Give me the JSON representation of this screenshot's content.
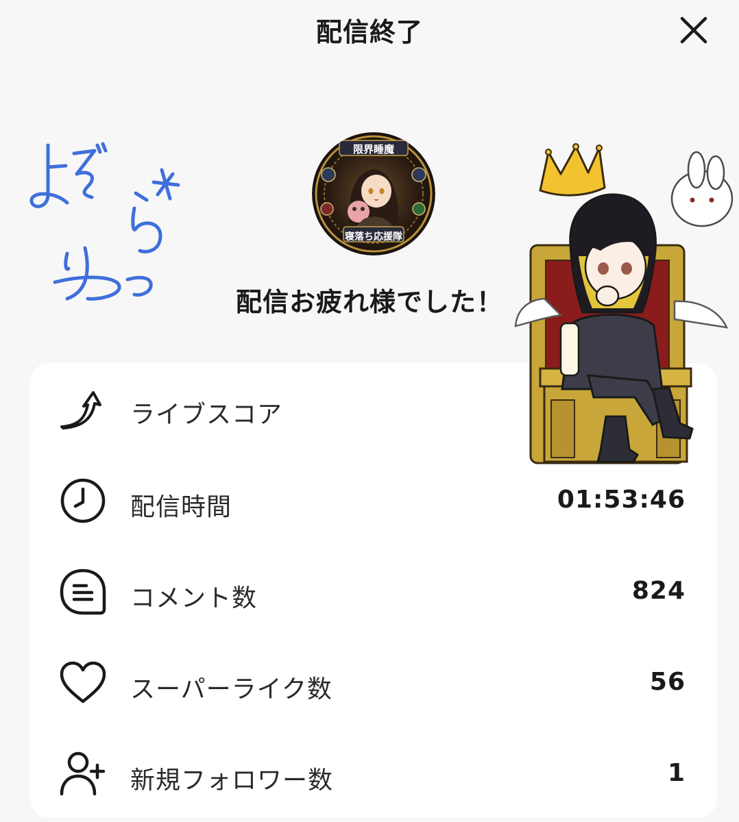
{
  "header": {
    "title": "配信終了",
    "close_icon": "close-icon"
  },
  "signature": {
    "text": "よぞらりつ",
    "color": "#3f6fdc"
  },
  "avatar": {
    "caption_top": "限界睡魔",
    "caption_bottom": "寝落ち応援隊"
  },
  "subtitle": "配信お疲れ様でした！",
  "stats": [
    {
      "icon": "trending-up-arrow-icon",
      "label": "ライブスコア",
      "value": ""
    },
    {
      "icon": "clock-icon",
      "label": "配信時間",
      "value": "01:53:46"
    },
    {
      "icon": "comment-icon",
      "label": "コメント数",
      "value": "824"
    },
    {
      "icon": "heart-icon",
      "label": "スーパーライク数",
      "value": "56"
    },
    {
      "icon": "user-plus-icon",
      "label": "新規フォロワー数",
      "value": "1"
    }
  ],
  "colors": {
    "background": "#f7f7f7",
    "card": "#ffffff",
    "text": "#1a1a1a",
    "signature_blue": "#3f6fdc",
    "crown_gold": "#f2c230"
  }
}
